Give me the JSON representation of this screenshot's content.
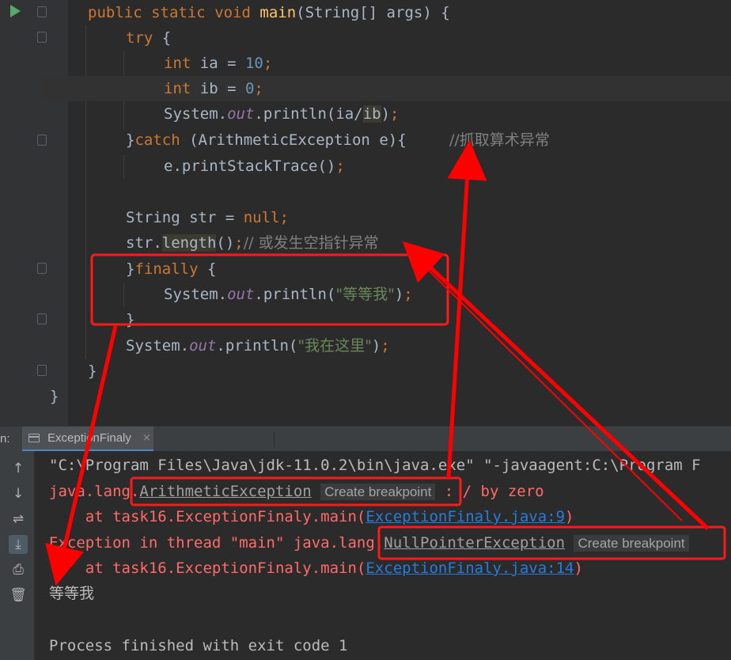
{
  "editor": {
    "lines": [
      [
        "public static void main(String[] args) {"
      ],
      [
        "try {"
      ],
      [
        "int ia = 10;"
      ],
      [
        "int ib = 0;"
      ],
      [
        "System.out.println(ia/ib);"
      ],
      [
        "}catch (ArithmeticException e){",
        "//抓取算术异常"
      ],
      [
        "e.printStackTrace();"
      ],
      [
        ""
      ],
      [
        "String str = null;"
      ],
      [
        "str.length();",
        "// 或发生空指针异常"
      ],
      [
        "}finally {"
      ],
      [
        "System.out.println(\"等等我\");"
      ],
      [
        "}"
      ],
      [
        "System.out.println(\"我在这里\");"
      ],
      [
        "}"
      ],
      [
        "}"
      ]
    ],
    "tokens": {
      "public": "public",
      "static": "static",
      "void": "void",
      "main": "main",
      "params": "(String[] args) {",
      "try": "try",
      "brace_open": " {",
      "int": "int",
      "ia_decl": " ia = ",
      "ia_val": "10",
      "ib_decl": " ib = ",
      "ib_val": "0",
      "semi": ";",
      "system": "System.",
      "out": "out",
      "println_open": ".println(",
      "ia_div": "ia/",
      "ib": "ib",
      "close_paren": ")",
      "catch_brace": "}",
      "catch": "catch",
      "catch_args": " (ArithmeticException e){",
      "catch_comment": "//抓取算术异常",
      "print_stack": "e.printStackTrace()",
      "string_decl": "String str = ",
      "null": "null",
      "str_dot": "str.",
      "length": "length",
      "length_call": "()",
      "npe_comment": "// 或发生空指针异常",
      "finally": "finally",
      "str_wait": "\"等等我\"",
      "close_brace": "}",
      "str_here": "\"我在这里\""
    }
  },
  "run_panel": {
    "label": "n:",
    "tab_name": "ExceptionFinaly",
    "tab_close": "×",
    "toolbar_icons": [
      "arrow-up-icon",
      "arrow-down-icon",
      "soft-wrap-icon",
      "scroll-to-end-icon",
      "print-icon",
      "trash-icon"
    ],
    "toolbar_glyphs": [
      "↑",
      "↓",
      "⇌",
      "⤓",
      "⎙",
      "🗑"
    ]
  },
  "console": {
    "cmd_line": "\"C:\\Program Files\\Java\\jdk-11.0.2\\bin\\java.exe\" \"-javaagent:C:\\Program F",
    "line2_prefix": "java.lang.",
    "line2_exception": "ArithmeticException",
    "hint": "Create breakpoint",
    "line2_suffix": ": / by zero",
    "line3_prefix": "    at task16.ExceptionFinaly.main(",
    "line3_link": "ExceptionFinaly.java:9",
    "line3_suffix": ")",
    "line4_prefix": "Exception in thread \"main\" java.lang.",
    "line4_exception": "NullPointerException",
    "line5_prefix": "    at task16.ExceptionFinaly.main(",
    "line5_link": "ExceptionFinaly.java:14",
    "line5_suffix": ")",
    "line6": "等等我",
    "line7": "",
    "line8": "Process finished with exit code 1"
  },
  "colors": {
    "keyword": "#cc7832",
    "number": "#6897bb",
    "static_field": "#9876aa",
    "method_decl": "#ffc66d",
    "comment": "#808080",
    "string": "#6a8759",
    "error": "#ff6b68",
    "link": "#287bde",
    "annotation": "#ff0000"
  }
}
